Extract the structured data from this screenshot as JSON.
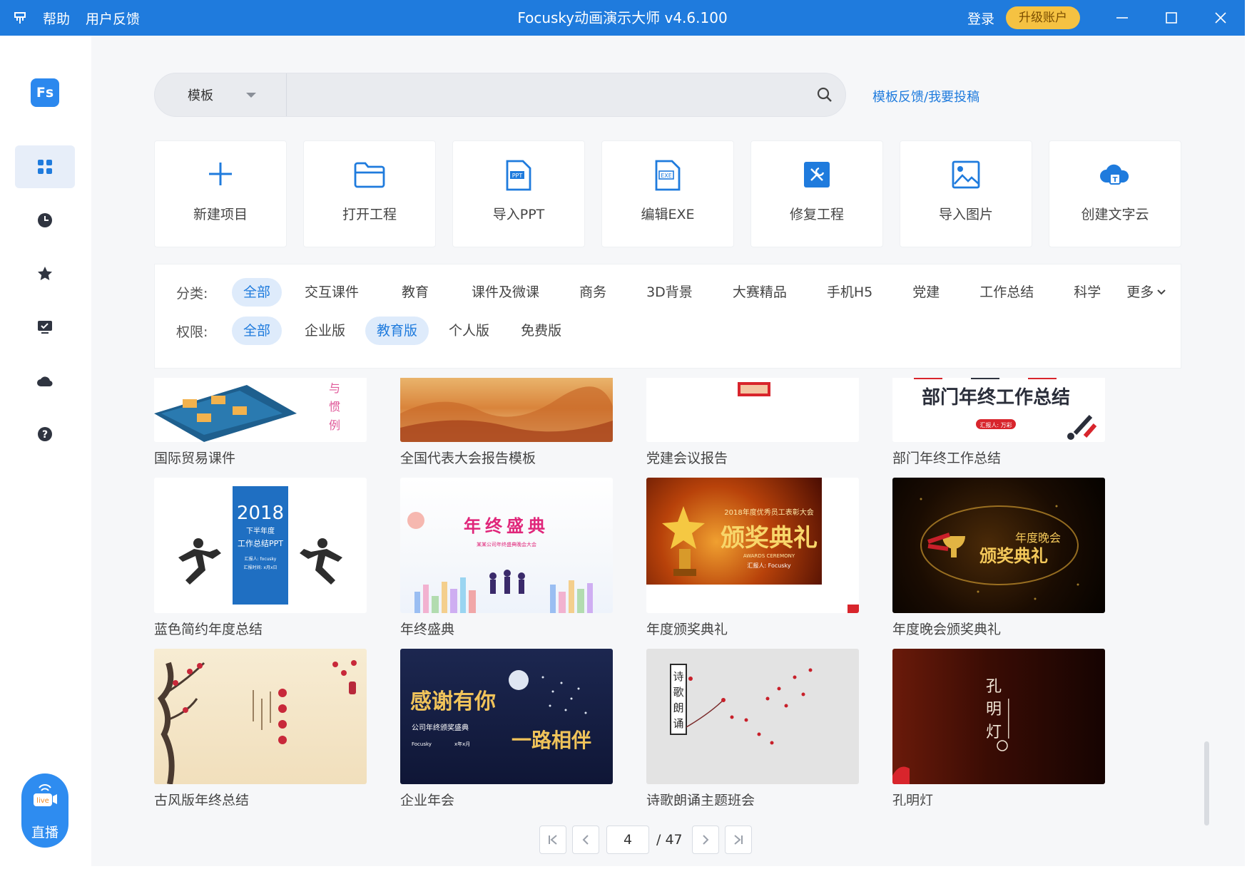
{
  "titlebar": {
    "menu_icon": "pin-icon",
    "help": "帮助",
    "feedback": "用户反馈",
    "title": "Focusky动画演示大师 v4.6.100",
    "login": "登录",
    "upgrade": "升级账户",
    "accent": "#1f7bdd"
  },
  "sidebar": {
    "logo": "Fs",
    "items": [
      {
        "icon": "grid-icon",
        "active": true
      },
      {
        "icon": "clock-icon"
      },
      {
        "icon": "star-icon"
      },
      {
        "icon": "presentation-icon"
      },
      {
        "icon": "cloud-icon"
      },
      {
        "icon": "help-icon"
      }
    ],
    "live_badge": "live",
    "live_label": "直播"
  },
  "search": {
    "category": "模板",
    "placeholder": "",
    "feedback_link": "模板反馈/我要投稿"
  },
  "quick_actions": [
    {
      "label": "新建项目",
      "icon": "plus-icon"
    },
    {
      "label": "打开工程",
      "icon": "folder-icon"
    },
    {
      "label": "导入PPT",
      "icon": "ppt-file-icon",
      "badge": "PPT"
    },
    {
      "label": "编辑EXE",
      "icon": "exe-file-icon",
      "badge": "EXE"
    },
    {
      "label": "修复工程",
      "icon": "repair-icon"
    },
    {
      "label": "导入图片",
      "icon": "image-icon"
    },
    {
      "label": "创建文字云",
      "icon": "word-cloud-icon",
      "badge": "T"
    }
  ],
  "filters": {
    "category_label": "分类:",
    "categories": [
      "全部",
      "交互课件",
      "教育",
      "课件及微课",
      "商务",
      "3D背景",
      "大赛精品",
      "手机H5",
      "党建",
      "工作总结",
      "科学"
    ],
    "more": "更多",
    "permission_label": "权限:",
    "permissions": [
      "全部",
      "企业版",
      "教育版",
      "个人版",
      "免费版"
    ],
    "selected_category": "全部",
    "selected_permissions": [
      "全部",
      "教育版"
    ]
  },
  "templates": [
    {
      "title": "国际贸易课件",
      "thumb_text": [
        "与",
        "惯",
        "例"
      ]
    },
    {
      "title": "全国代表大会报告模板"
    },
    {
      "title": "党建会议报告"
    },
    {
      "title": "部门年终工作总结",
      "thumb_text": [
        "部门年终工作总结",
        "汇报人: 万彩"
      ]
    },
    {
      "title": "蓝色简约年度总结",
      "thumb_text": [
        "2018",
        "下半年度",
        "工作总结PPT",
        "汇报人: focusky",
        "汇报时间: x月x日"
      ]
    },
    {
      "title": "年终盛典",
      "thumb_text": [
        "年终盛典",
        "某某公司年终盛典晚会大会"
      ]
    },
    {
      "title": "年度颁奖典礼",
      "thumb_text": [
        "2018年度优秀员工表彰大会",
        "颁奖典礼",
        "AWARDS CEREMONY",
        "汇报人: Focusky"
      ]
    },
    {
      "title": "年度晚会颁奖典礼",
      "thumb_text": [
        "年度晚会",
        "颁奖典礼"
      ]
    },
    {
      "title": "古风版年终总结"
    },
    {
      "title": "企业年会",
      "thumb_text": [
        "感谢有你",
        "公司年终颁奖盛典",
        "Focusky",
        "x年x月",
        "一路相伴"
      ]
    },
    {
      "title": "诗歌朗诵主题班会",
      "thumb_text": [
        "诗",
        "歌",
        "朗",
        "诵"
      ]
    },
    {
      "title": "孔明灯",
      "thumb_text": [
        "孔",
        "明",
        "灯"
      ]
    }
  ],
  "pagination": {
    "current": "4",
    "total": "/ 47"
  }
}
